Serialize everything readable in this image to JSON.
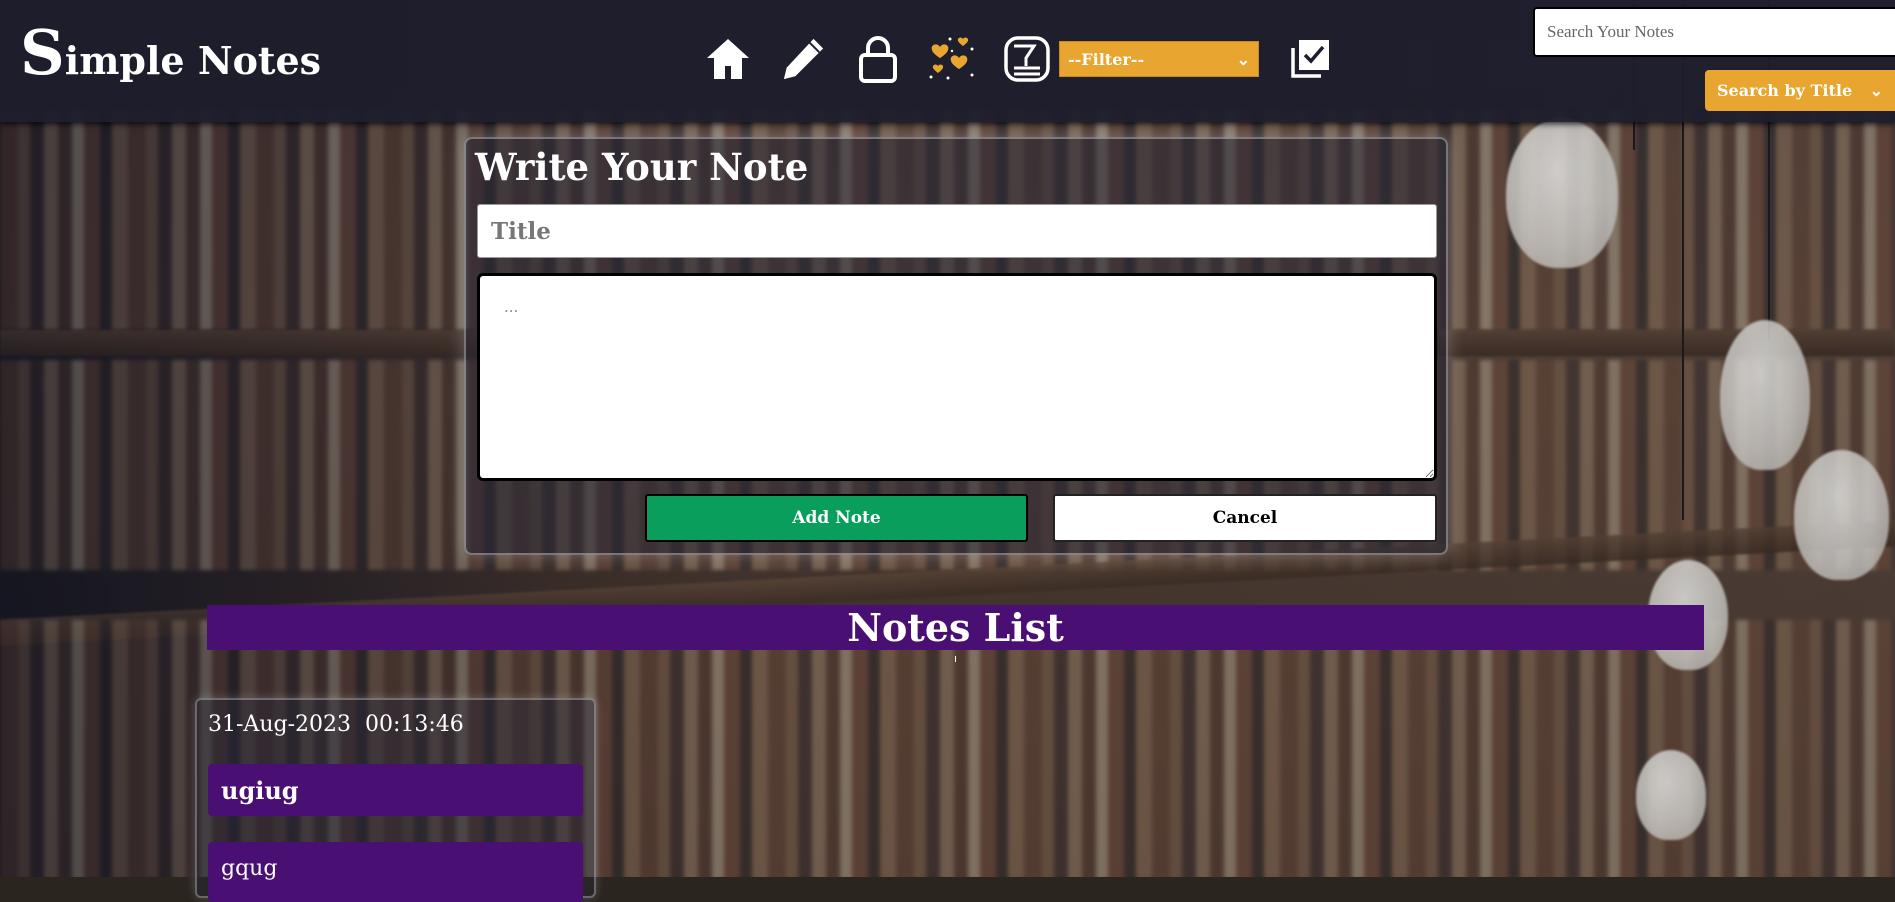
{
  "app": {
    "logo_first": "S",
    "logo_rest": "imple Notes"
  },
  "nav": {
    "icons": [
      "home-icon",
      "pencil-icon",
      "lock-icon",
      "hearts-icon",
      "archive-icon"
    ],
    "filter_label": "--Filter--",
    "archive_icon": "checked-stack-icon"
  },
  "search": {
    "placeholder": "Search Your Notes",
    "mode_label": "Search by Title"
  },
  "editor": {
    "heading": "Write Your Note",
    "title_placeholder": "Title",
    "body_placeholder": "...",
    "add_label": "Add Note",
    "cancel_label": "Cancel"
  },
  "notes_list": {
    "heading": "Notes List",
    "notes": [
      {
        "date": "31-Aug-2023",
        "time": "00:13:46",
        "title": "ugiug",
        "body": "gqug"
      }
    ]
  },
  "colors": {
    "header_bg": "#1e1d2c",
    "accent_orange": "#e8a530",
    "add_green": "#0a9e5c",
    "purple": "#4a0f72"
  }
}
